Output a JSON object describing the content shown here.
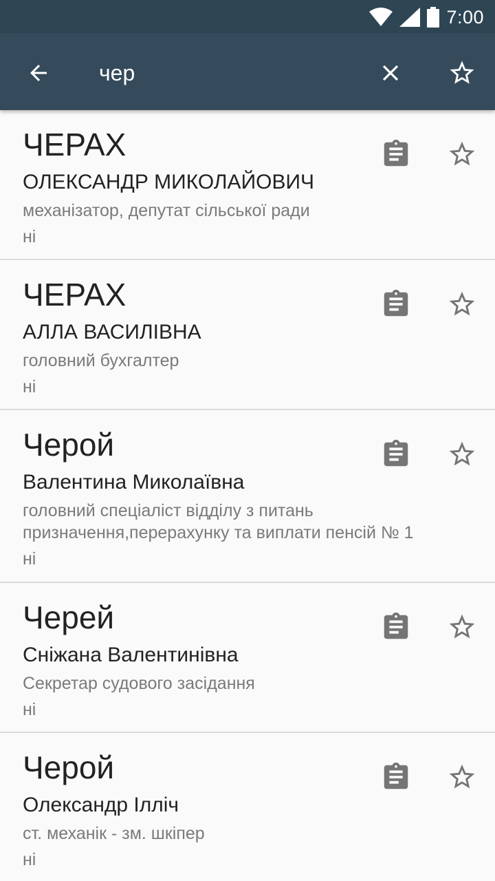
{
  "status_bar": {
    "time": "7:00"
  },
  "search": {
    "query": "чер"
  },
  "results": [
    {
      "surname": "ЧЕРАХ",
      "given": "ОЛЕКСАНДР МИКОЛАЙОВИЧ",
      "position": "механізатор, депутат сільської ради",
      "flag": "ні"
    },
    {
      "surname": "ЧЕРАХ",
      "given": "АЛЛА ВАСИЛІВНА",
      "position": "головний бухгалтер",
      "flag": "ні"
    },
    {
      "surname": "Черой",
      "given": "Валентина Миколаївна",
      "position": "головний спеціаліст відділу з питань призначення,перерахунку та виплати пенсій № 1",
      "flag": "ні"
    },
    {
      "surname": "Черей",
      "given": "Сніжана Валентинівна",
      "position": "Секретар судового засідання",
      "flag": "ні"
    },
    {
      "surname": "Черой",
      "given": "Олександр Ілліч",
      "position": "ст. механік - зм. шкіпер",
      "flag": "ні"
    }
  ],
  "icons": {
    "back": "arrow-back-icon",
    "clear": "close-icon",
    "favorites": "star-outline-icon",
    "item_document": "clipboard-text-icon",
    "item_favorite": "star-outline-icon"
  },
  "colors": {
    "status_bar": "#2e4554",
    "app_bar": "#354b5b",
    "background": "#fafafa",
    "icon_gray": "#757575"
  }
}
